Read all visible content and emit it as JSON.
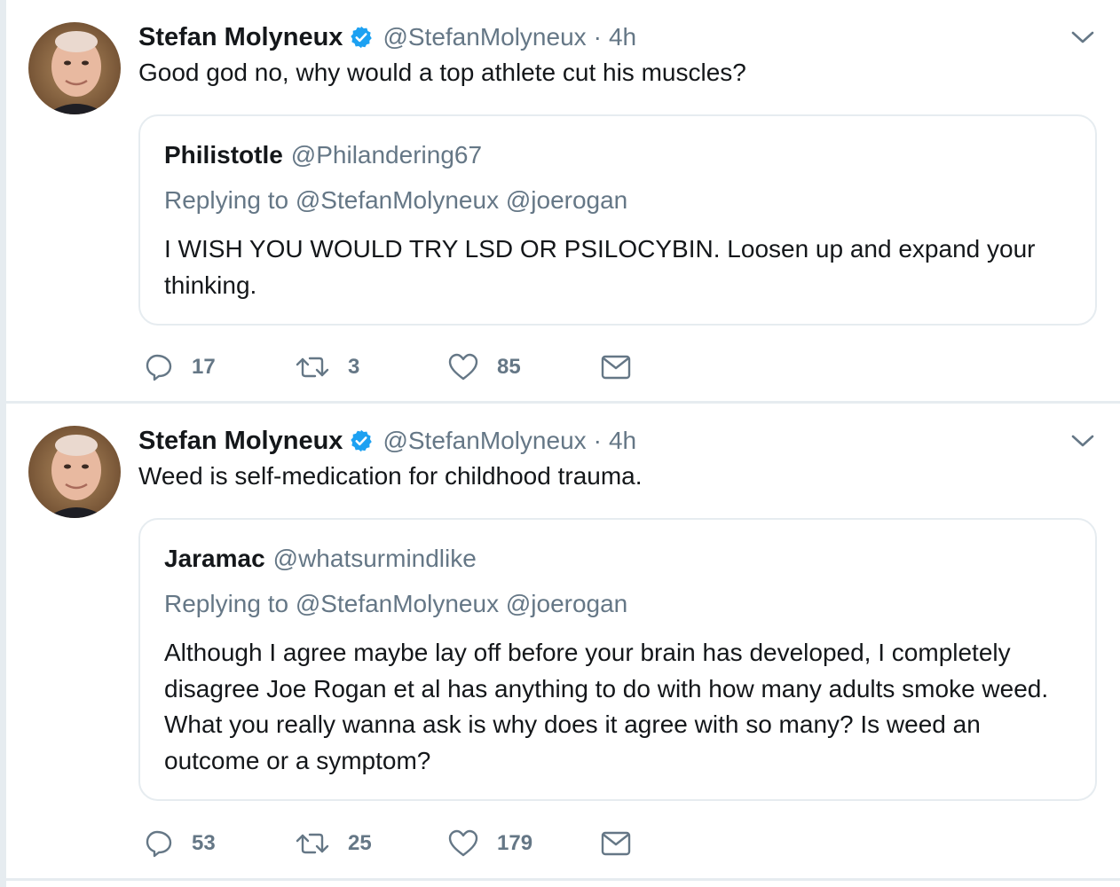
{
  "tweets": [
    {
      "author": {
        "name": "Stefan Molyneux",
        "handle": "@StefanMolyneux",
        "verified": true
      },
      "time": "4h",
      "separator": "·",
      "text": "Good god no, why would a top athlete cut his muscles?",
      "quoted": {
        "name": "Philistotle",
        "handle": "@Philandering67",
        "replying_to": "Replying to @StefanMolyneux @joerogan",
        "text": "I WISH YOU WOULD TRY LSD OR PSILOCYBIN. Loosen up and expand your thinking."
      },
      "actions": {
        "replies": "17",
        "retweets": "3",
        "likes": "85"
      }
    },
    {
      "author": {
        "name": "Stefan Molyneux",
        "handle": "@StefanMolyneux",
        "verified": true
      },
      "time": "4h",
      "separator": "·",
      "text": "Weed is self-medication for childhood trauma.",
      "quoted": {
        "name": "Jaramac",
        "handle": "@whatsurmindlike",
        "replying_to": "Replying to @StefanMolyneux @joerogan",
        "text": "Although I agree maybe lay off before your brain has developed, I completely disagree Joe Rogan et al has anything to do with how many adults smoke weed. What you really wanna ask is why does it agree with so many? Is weed an outcome or a symptom?"
      },
      "actions": {
        "replies": "53",
        "retweets": "25",
        "likes": "179"
      }
    }
  ],
  "colors": {
    "text": "#14171a",
    "secondary": "#657786",
    "verified": "#1da1f2",
    "border": "#e6ecf0"
  },
  "icons": [
    "verified-badge-icon",
    "chevron-down-icon",
    "reply-icon",
    "retweet-icon",
    "like-icon",
    "direct-message-icon"
  ]
}
